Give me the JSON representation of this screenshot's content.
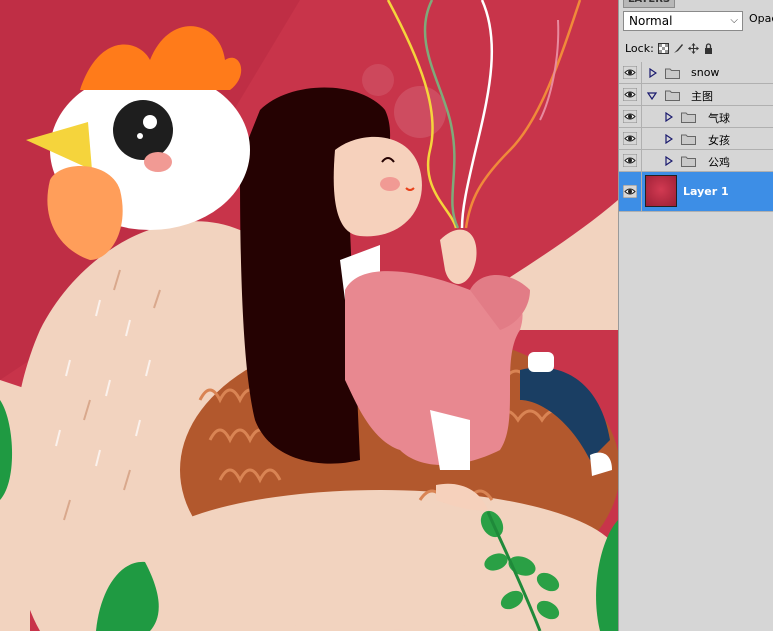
{
  "panel": {
    "tab_label": "LAYERS",
    "blend_mode": "Normal",
    "opacity_label": "Opac",
    "lock_label": "Lock:",
    "layers": [
      {
        "name": "snow",
        "type": "group",
        "expanded": false,
        "visible": true,
        "indent": 0
      },
      {
        "name": "主图",
        "type": "group",
        "expanded": true,
        "visible": true,
        "indent": 0
      },
      {
        "name": "气球",
        "type": "group",
        "expanded": false,
        "visible": true,
        "indent": 1
      },
      {
        "name": "女孩",
        "type": "group",
        "expanded": false,
        "visible": true,
        "indent": 1
      },
      {
        "name": "公鸡",
        "type": "group",
        "expanded": false,
        "visible": true,
        "indent": 1
      },
      {
        "name": "Layer 1",
        "type": "layer",
        "selected": true,
        "visible": true,
        "indent": 0
      }
    ]
  },
  "colors": {
    "background": "#c8344a",
    "selection": "#3d8ee6",
    "rooster_body": "#f2d3bf",
    "hair": "#250202",
    "dress": "#e88890",
    "nest": "#b2582d"
  },
  "icons": [
    "eye-icon",
    "folder-icon",
    "expand-triangle-icon",
    "lock-transparent-icon",
    "lock-paint-icon",
    "lock-move-icon",
    "lock-all-icon"
  ]
}
